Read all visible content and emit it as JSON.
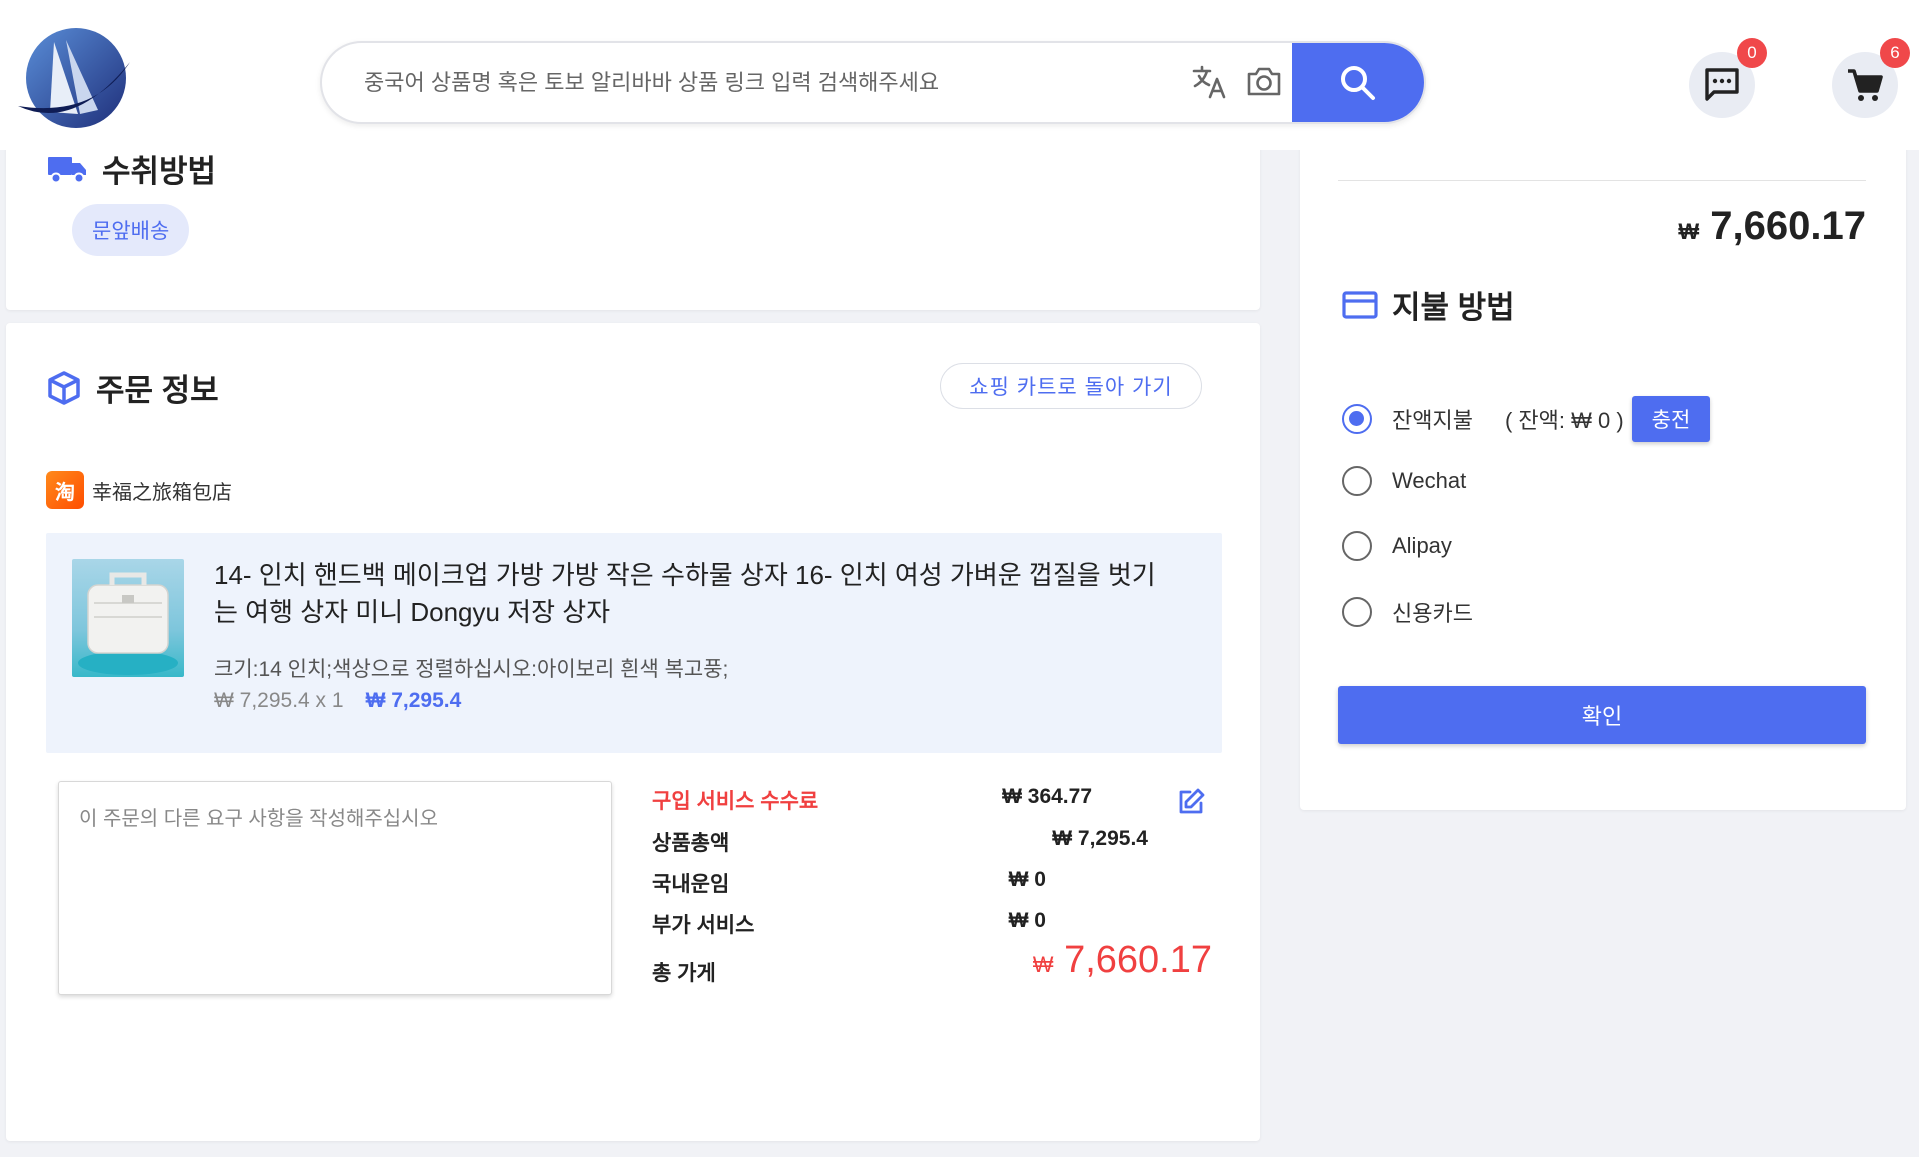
{
  "header": {
    "search": {
      "placeholder": "중국어 상품명 혹은 토보 알리바바 상품 링크 입력 검색해주세요",
      "value": ""
    },
    "messages_badge": "0",
    "cart_badge": "6"
  },
  "delivery": {
    "title": "수취방법",
    "method": "문앞배송"
  },
  "order": {
    "title": "주문 정보",
    "back_to_cart": "쇼핑 카트로 돌아 가기",
    "shop_logo_text": "淘",
    "shop_name": "幸福之旅箱包店",
    "product": {
      "title": "14- 인치 핸드백 메이크업 가방 가방 작은 수하물 상자 16- 인치 여성 가벼운 껍질을 벗기는 여행 상자 미니 Dongyu 저장 상자",
      "spec": "크기:14 인치;색상으로 정렬하십시오:아이보리 흰색 복고풍;",
      "unit_price": "₩ 7,295.4 x 1",
      "line_total": "₩ 7,295.4"
    },
    "memo_placeholder": "이 주문의 다른 요구 사항을 작성해주십시오",
    "fees": {
      "service_fee_label": "구입 서비스 수수료",
      "service_fee_value": "₩ 364.77",
      "goods_total_label": "상품총액",
      "goods_total_value": "₩ 7,295.4",
      "domestic_shipping_label": "국내운임",
      "domestic_shipping_value": "₩ 0",
      "extra_service_label": "부가 서비스",
      "extra_service_value": "₩ 0",
      "grand_total_label": "총 가게",
      "grand_total_currency": "₩",
      "grand_total_value": "7,660.17"
    }
  },
  "payment": {
    "total_currency": "₩",
    "total_value": "7,660.17",
    "title": "지불 방법",
    "options": [
      {
        "label": "잔액지불",
        "selected": true
      },
      {
        "label": "Wechat",
        "selected": false
      },
      {
        "label": "Alipay",
        "selected": false
      },
      {
        "label": "신용카드",
        "selected": false
      }
    ],
    "balance_text": "( 잔액: ₩ 0 )",
    "charge_label": "충전",
    "confirm_label": "확인"
  },
  "colors": {
    "accent": "#4e6df0",
    "price_red": "#f04040",
    "badge_red": "#f0484a"
  }
}
